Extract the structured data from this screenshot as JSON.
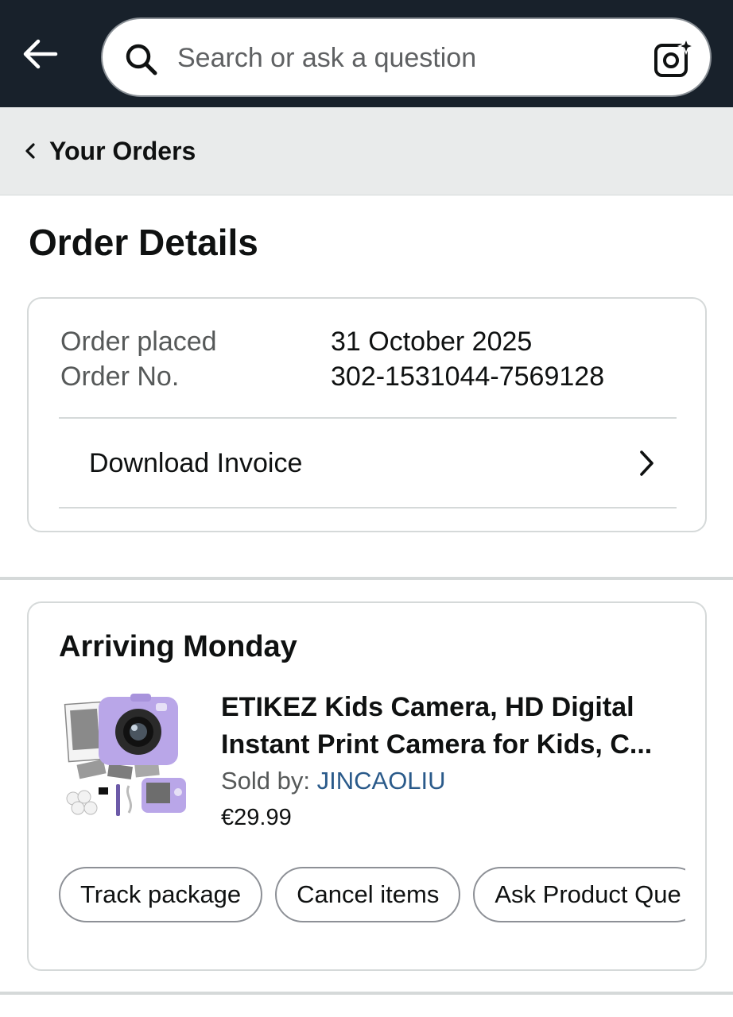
{
  "header": {
    "search_placeholder": "Search or ask a question"
  },
  "breadcrumb": {
    "label": "Your Orders"
  },
  "page": {
    "title": "Order Details"
  },
  "order": {
    "placed_label": "Order placed",
    "placed_value": "31 October 2025",
    "number_label": "Order No.",
    "number_value": "302-1531044-7569128",
    "invoice_label": "Download Invoice"
  },
  "shipment": {
    "status": "Arriving Monday",
    "product": {
      "title": "ETIKEZ Kids Camera, HD Digital Instant Print Camera for Kids, C...",
      "sold_by_label": "Sold by: ",
      "seller": "JINCAOLIU",
      "price": "€29.99"
    },
    "actions": [
      "Track package",
      "Cancel items",
      "Ask Product Que"
    ]
  },
  "colors": {
    "header_bg": "#18212b",
    "crumb_bg": "#e9ebeb",
    "link": "#2a5a8a",
    "product_purple": "#b9a6e8"
  }
}
